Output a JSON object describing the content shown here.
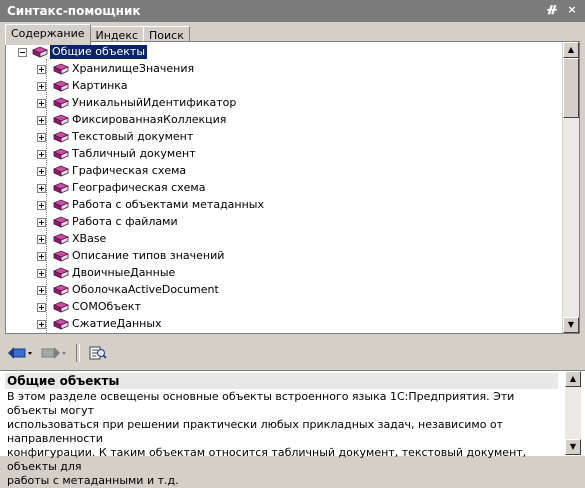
{
  "window": {
    "title": "Синтакс-помощник",
    "pin_glyph": "ᚌ",
    "close_glyph": "×"
  },
  "tabs": [
    {
      "label": "Содержание",
      "active": true
    },
    {
      "label": "Индекс",
      "active": false
    },
    {
      "label": "Поиск",
      "active": false
    }
  ],
  "tree": {
    "root": {
      "label": "Общие объекты",
      "expanded": true,
      "selected": true
    },
    "children": [
      "ХранилищеЗначения",
      "Картинка",
      "УникальныйИдентификатор",
      "ФиксированнаяКоллекция",
      "Текстовый документ",
      "Табличный документ",
      "Графическая схема",
      "Географическая схема",
      "Работа с объектами метаданных",
      "Работа с файлами",
      "XBase",
      "Описание типов значений",
      "ДвоичныеДанные",
      "ОболочкаActiveDocument",
      "COMОбъект",
      "СжатиеДанных"
    ]
  },
  "scroll_arrows": {
    "up": "▲",
    "down": "▼"
  },
  "description": {
    "title": "Общие объекты",
    "lines": [
      "В этом разделе освещены основные объекты встроенного языка 1С:Предприятия. Эти объекты могут",
      "использоваться при решении практически любых прикладных задач, независимо от направленности",
      "конфигурации. К таким объектам относится табличный документ, текстовый документ, объекты для",
      "работы с метаданными и т.д."
    ]
  },
  "colors": {
    "selection": "#0a246a",
    "book": "#8b1d6e"
  }
}
